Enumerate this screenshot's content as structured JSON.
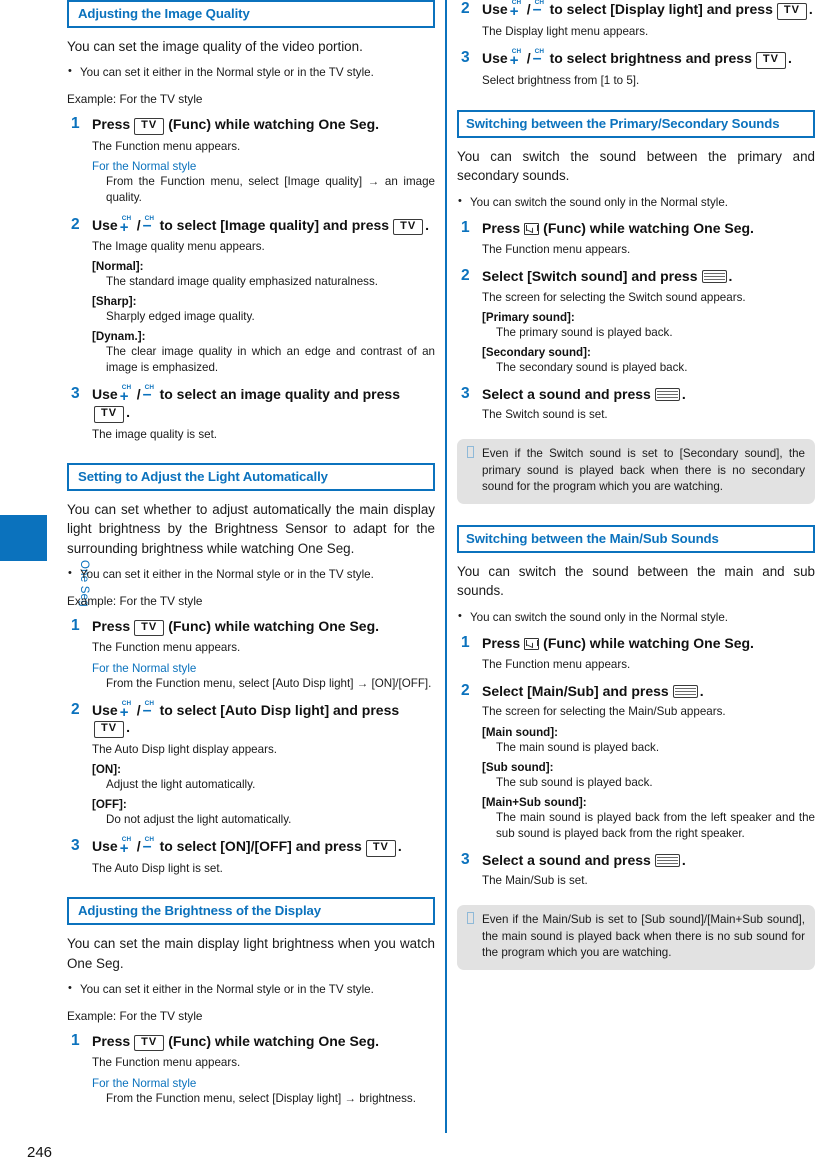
{
  "page": {
    "number": "246",
    "side_tab_label": "One Seg",
    "accent_color": "#0b72bd",
    "note_bg_color": "#e2e2e2"
  },
  "keys": {
    "tv": "TV",
    "ch_up": "CH+",
    "ch_down": "CH-",
    "mail": "mail-key",
    "select": "select-key"
  },
  "left_column": {
    "sections": [
      {
        "heading": "Adjusting the Image Quality",
        "intro": "You can set the image quality of the video portion.",
        "bullet": "You can set it either in the Normal style or in the TV style.",
        "example": "Example: For the TV style",
        "steps": [
          {
            "num": "1",
            "title_pre": "Press",
            "title_post": "(Func) while watching One Seg.",
            "result": "The Function menu appears.",
            "normal_style_label": "For the Normal style",
            "normal_style_body": "From the Function menu, select [Image quality] → an image quality."
          },
          {
            "num": "2",
            "title_pre": "Use",
            "title_mid": "to select [Image quality] and press",
            "title_post": ".",
            "result": "The Image quality menu appears.",
            "options": [
              {
                "label": "[Normal]:",
                "desc": "The standard image quality emphasized naturalness."
              },
              {
                "label": "[Sharp]:",
                "desc": "Sharply edged image quality."
              },
              {
                "label": "[Dynam.]:",
                "desc": "The clear image quality in which an edge and contrast of an image is emphasized."
              }
            ]
          },
          {
            "num": "3",
            "title_pre": "Use",
            "title_mid": "to select an image quality and press",
            "title_post": ".",
            "result": "The image quality is set."
          }
        ]
      },
      {
        "heading": "Setting to Adjust the Light Automatically",
        "intro": "You can set whether to adjust automatically the main display light brightness by the Brightness Sensor to adapt for the surrounding brightness while watching One Seg.",
        "bullet": "You can set it either in the Normal style or in the TV style.",
        "example": "Example: For the TV style",
        "steps": [
          {
            "num": "1",
            "title_pre": "Press",
            "title_post": "(Func) while watching One Seg.",
            "result": "The Function menu appears.",
            "normal_style_label": "For the Normal style",
            "normal_style_body": "From the Function menu, select [Auto Disp light] → [ON]/[OFF]."
          },
          {
            "num": "2",
            "title_pre": "Use",
            "title_mid": "to select [Auto Disp light] and press",
            "title_post": ".",
            "result": "The Auto Disp light display appears.",
            "options": [
              {
                "label": "[ON]:",
                "desc": "Adjust the light automatically."
              },
              {
                "label": "[OFF]:",
                "desc": "Do not adjust the light automatically."
              }
            ]
          },
          {
            "num": "3",
            "title_pre": "Use",
            "title_mid": "to select [ON]/[OFF] and press",
            "title_post": ".",
            "result": "The Auto Disp light is set."
          }
        ]
      },
      {
        "heading": "Adjusting the Brightness of the Display",
        "intro": "You can set the main display light brightness when you watch One Seg.",
        "bullet": "You can set it either in the Normal style or in the TV style.",
        "example": "Example: For the TV style",
        "steps": [
          {
            "num": "1",
            "title_pre": "Press",
            "title_post": "(Func) while watching One Seg.",
            "result": "The Function menu appears.",
            "normal_style_label": "For the Normal style",
            "normal_style_body": "From the Function menu, select [Display light] → brightness."
          }
        ]
      }
    ]
  },
  "right_column": {
    "continued_steps": [
      {
        "num": "2",
        "title_pre": "Use",
        "title_mid": "to select [Display light] and press",
        "title_post": ".",
        "result": "The Display light menu appears."
      },
      {
        "num": "3",
        "title_pre": "Use",
        "title_mid": "to select brightness and press",
        "title_post": ".",
        "result": "Select brightness from [1 to 5]."
      }
    ],
    "sections": [
      {
        "heading": "Switching between the Primary/Secondary Sounds",
        "intro": "You can switch the sound between the primary and secondary sounds.",
        "bullet": "You can switch the sound only in the Normal style.",
        "steps": [
          {
            "num": "1",
            "title_pre": "Press",
            "title_post": "(Func) while watching One Seg.",
            "result": "The Function menu appears."
          },
          {
            "num": "2",
            "title_pre": "Select [Switch sound] and press",
            "title_post": ".",
            "result": "The screen for selecting the Switch sound appears.",
            "options": [
              {
                "label": "[Primary sound]:",
                "desc": "The primary sound is played back."
              },
              {
                "label": "[Secondary sound]:",
                "desc": "The secondary sound is played back."
              }
            ]
          },
          {
            "num": "3",
            "title_pre": "Select a sound and press",
            "title_post": ".",
            "result": "The Switch sound is set."
          }
        ],
        "note": "Even if the Switch sound is set to [Secondary sound], the primary sound is played back when there is no secondary sound for the program which you are watching."
      },
      {
        "heading": "Switching between the Main/Sub Sounds",
        "intro": "You can switch the sound between the main and sub sounds.",
        "bullet": "You can switch the sound only in the Normal style.",
        "steps": [
          {
            "num": "1",
            "title_pre": "Press",
            "title_post": "(Func) while watching One Seg.",
            "result": "The Function menu appears."
          },
          {
            "num": "2",
            "title_pre": "Select [Main/Sub] and press",
            "title_post": ".",
            "result": "The screen for selecting the Main/Sub appears.",
            "options": [
              {
                "label": "[Main sound]:",
                "desc": "The main sound is played back."
              },
              {
                "label": "[Sub sound]:",
                "desc": "The sub sound is played back."
              },
              {
                "label": "[Main+Sub sound]:",
                "desc": "The main sound is played back from the left speaker and the sub sound is played back from the right speaker."
              }
            ]
          },
          {
            "num": "3",
            "title_pre": "Select a sound and press",
            "title_post": ".",
            "result": "The Main/Sub is set."
          }
        ],
        "note": "Even if the Main/Sub is set to [Sub sound]/[Main+Sub sound], the main sound is played back when there is no sub sound for the program which you are watching."
      }
    ]
  }
}
